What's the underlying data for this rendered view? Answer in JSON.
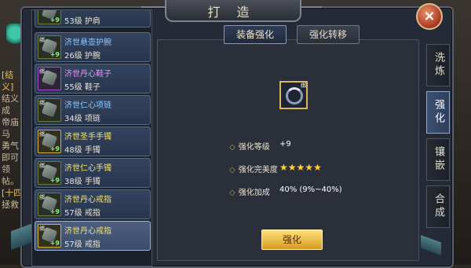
{
  "window": {
    "title": "打 造",
    "close_glyph": "×"
  },
  "background": {
    "lines": [
      {
        "text": "[结义]",
        "yellow": true
      },
      {
        "text": "结义成",
        "yellow": false
      },
      {
        "text": "帝庙马",
        "yellow": false
      },
      {
        "text": "勇气",
        "yellow": false
      },
      {
        "text": "即可领",
        "yellow": false
      },
      {
        "text": "帖。",
        "yellow": false
      },
      {
        "text": "[十四",
        "yellow": true
      },
      {
        "text": "拯救",
        "yellow": false
      }
    ]
  },
  "items": [
    {
      "name": "",
      "level": "53级 护肩",
      "plus": "+9",
      "frame": "green",
      "color": "blue",
      "selected": false
    },
    {
      "name": "济世悬壶护腕",
      "level": "26级 护腕",
      "plus": "+9",
      "frame": "green",
      "color": "blue",
      "selected": false
    },
    {
      "name": "济世丹心鞋子",
      "level": "55级 鞋子",
      "plus": "",
      "frame": "purple",
      "color": "purple",
      "selected": false
    },
    {
      "name": "济世仁心项链",
      "level": "34级 项链",
      "plus": "",
      "frame": "green",
      "color": "blue",
      "selected": false
    },
    {
      "name": "济世圣手手镯",
      "level": "48级 手镯",
      "plus": "+9",
      "frame": "yellow",
      "color": "yellow",
      "selected": false
    },
    {
      "name": "济世仁心手镯",
      "level": "38级 手镯",
      "plus": "+9",
      "frame": "green",
      "color": "yellow",
      "selected": false
    },
    {
      "name": "济世丹心戒指",
      "level": "57级 戒指",
      "plus": "+9",
      "frame": "green",
      "color": "yellow",
      "selected": false
    },
    {
      "name": "济世丹心戒指",
      "level": "57级 戒指",
      "plus": "+9",
      "frame": "yellow",
      "color": "yellow",
      "selected": true
    }
  ],
  "tabs": {
    "enhance": "装备强化",
    "transfer": "强化转移"
  },
  "equip": {
    "tag": "绑"
  },
  "stats": {
    "level_label": "强化等级",
    "level_value": "+9",
    "perfection_label": "强化完美度",
    "perfection_stars": 5,
    "bonus_label": "强化加成",
    "bonus_value": "40% (9%~40%)"
  },
  "action": {
    "enhance_button": "强化"
  },
  "side_tabs": [
    {
      "label": "洗炼",
      "active": false
    },
    {
      "label": "强化",
      "active": true
    },
    {
      "label": "镶嵌",
      "active": false
    },
    {
      "label": "合成",
      "active": false
    }
  ]
}
